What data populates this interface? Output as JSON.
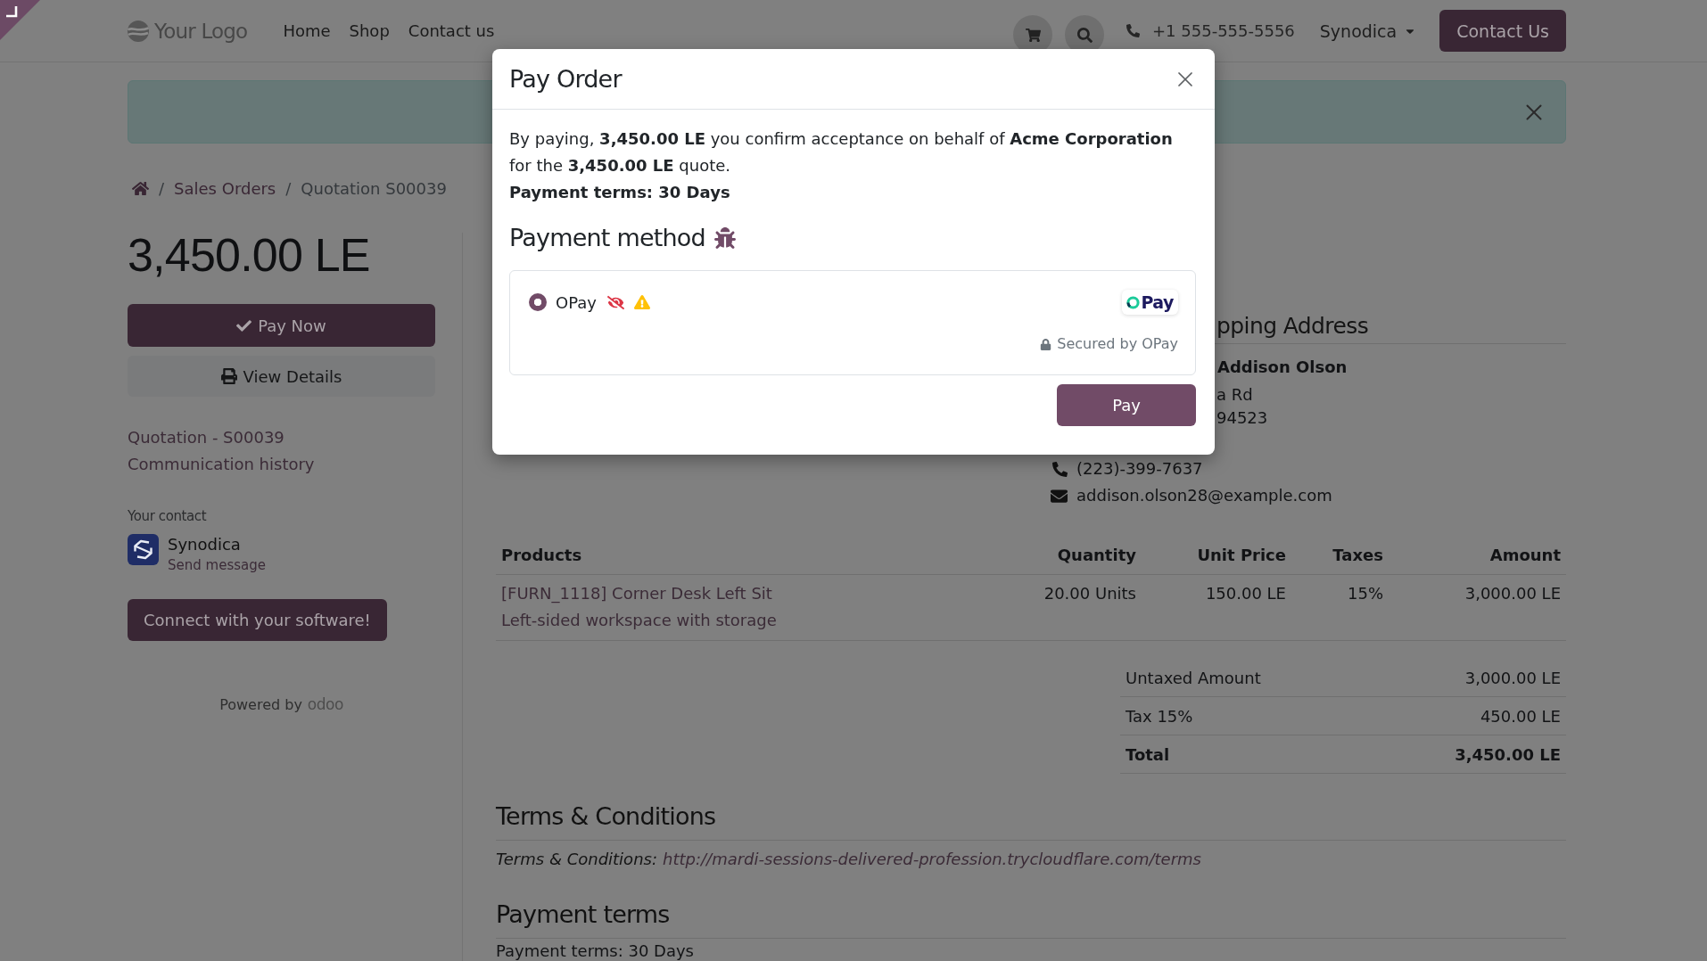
{
  "navbar": {
    "logo_text": "Your Logo",
    "links": [
      "Home",
      "Shop",
      "Contact us"
    ],
    "phone": "+1 555-555-5556",
    "user_menu": "Synodica",
    "cta_button": "Contact Us"
  },
  "breadcrumb": [
    {
      "separator": "/",
      "label": "Sales Orders"
    },
    {
      "separator": "/",
      "label": "Quotation S00039"
    }
  ],
  "sidebar": {
    "amount": "3,450.00 LE",
    "buttons": [
      {
        "label": "Pay Now",
        "kind": "primary"
      },
      {
        "label": "View Details",
        "kind": "secondary"
      }
    ],
    "links": [
      "Quotation - S00039",
      "Communication history"
    ],
    "contact_label": "Your contact",
    "contact_name": "Synodica",
    "contact_action": "Send message",
    "connect_button": "Connect with your software!",
    "powered_by": "Powered by",
    "powered_by_brand": "odoo"
  },
  "address": {
    "heading": "pping Address",
    "name": "Addison Olson",
    "lines": [
      "a Rd",
      "94523"
    ],
    "phone": "(223)-399-7637",
    "email": "addison.olson28@example.com"
  },
  "products_table": {
    "columns": [
      "Products",
      "Quantity",
      "Unit Price",
      "Taxes",
      "Amount"
    ],
    "rows": [
      {
        "product": "[FURN_1118] Corner Desk Left Sit",
        "description": "Left-sided workspace with storage",
        "quantity": "20.00 Units",
        "unit_price": "150.00 LE",
        "taxes": "15%",
        "amount": "3,000.00 LE"
      }
    ]
  },
  "totals": [
    {
      "label": "Untaxed Amount",
      "value": "3,000.00 LE",
      "kind": "subtotal"
    },
    {
      "label": "Tax 15%",
      "value": "450.00 LE",
      "kind": "subtotal"
    },
    {
      "label": "Total",
      "value": "3,450.00 LE",
      "kind": "total"
    }
  ],
  "terms": {
    "heading": "Terms & Conditions",
    "label": "Terms & Conditions:",
    "link": "http://mardi-sessions-delivered-profession.trycloudflare.com/terms"
  },
  "payment_terms": {
    "heading": "Payment terms",
    "text": "Payment terms: 30 Days"
  },
  "modal": {
    "title": "Pay Order",
    "message": "By paying, **3,450.00 LE** you confirm acceptance on behalf of **Acme Corporation** for the **3,450.00 LE** quote.",
    "terms": "Payment terms: 30 Days",
    "method_heading": "Payment method",
    "debug": true,
    "methods": [
      {
        "name": "OPay",
        "selected": true,
        "published": false,
        "test_mode": true,
        "logo_text": "Pay",
        "secured_by": "Secured by OPay"
      }
    ],
    "pay_button": "Pay"
  }
}
